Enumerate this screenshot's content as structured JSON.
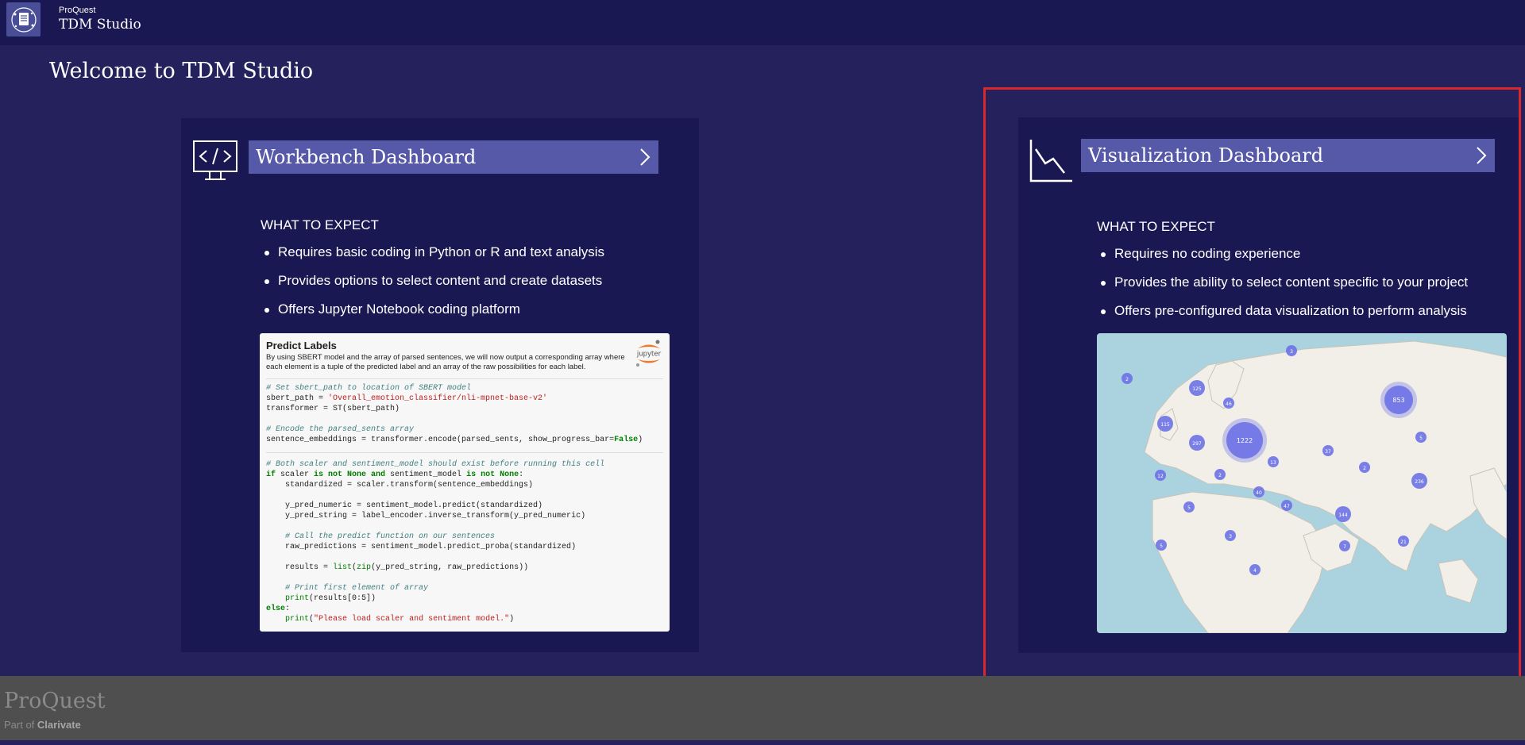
{
  "header": {
    "brand_small": "ProQuest",
    "brand_big": "TDM Studio"
  },
  "page": {
    "title": "Welcome to TDM Studio"
  },
  "workbench": {
    "button_label": "Workbench Dashboard",
    "expect_heading": "WHAT TO EXPECT",
    "bullets": [
      "Requires basic coding in Python or R and text analysis",
      "Provides options to select content and create datasets",
      "Offers Jupyter Notebook coding platform"
    ],
    "preview": {
      "title": "Predict Labels",
      "description": "By using SBERT model and the array of parsed sentences, we will now output a corresponding array where each element is a tuple of the predicted label and an array of the raw possibilities for each label.",
      "logo_text": "jupyter"
    }
  },
  "visualization": {
    "button_label": "Visualization Dashboard",
    "expect_heading": "WHAT TO EXPECT",
    "bullets": [
      "Requires no coding experience",
      "Provides the ability to select content specific to your project",
      "Offers pre-configured data visualization to perform analysis"
    ],
    "map_clusters": [
      {
        "label": "3",
        "lon": 0.47
      },
      {
        "label": "2",
        "lon": 0.09
      },
      {
        "label": "125",
        "lon": 0.3
      },
      {
        "label": "46",
        "lon": 0.4
      },
      {
        "label": "853",
        "lon": 0.9
      },
      {
        "label": "115",
        "lon": 0.21
      },
      {
        "label": "297",
        "lon": 0.3
      },
      {
        "label": "1222",
        "lon": 0.44
      },
      {
        "label": "37",
        "lon": 0.69
      },
      {
        "label": "5",
        "lon": 0.97
      },
      {
        "label": "12",
        "lon": 0.19
      },
      {
        "label": "2",
        "lon": 0.37
      },
      {
        "label": "13",
        "lon": 0.53
      },
      {
        "label": "2",
        "lon": 0.81
      },
      {
        "label": "236",
        "lon": 0.97
      },
      {
        "label": "40",
        "lon": 0.48
      },
      {
        "label": "47",
        "lon": 0.57
      },
      {
        "label": "5",
        "lon": 0.28
      },
      {
        "label": "144",
        "lon": 0.74
      },
      {
        "label": "3",
        "lon": 0.4
      },
      {
        "label": "5",
        "lon": 0.19
      },
      {
        "label": "7",
        "lon": 0.74
      },
      {
        "label": "21",
        "lon": 0.92
      },
      {
        "label": "4",
        "lon": 0.47
      }
    ]
  },
  "footer": {
    "logo_text": "ProQuest",
    "part_of_prefix": "Part of",
    "part_of_brand": "Clarivate"
  },
  "colors": {
    "background": "#24215c",
    "card": "#1a1852",
    "button": "#5658a8",
    "highlight": "#d9272e",
    "cluster": "#6d72e6"
  }
}
